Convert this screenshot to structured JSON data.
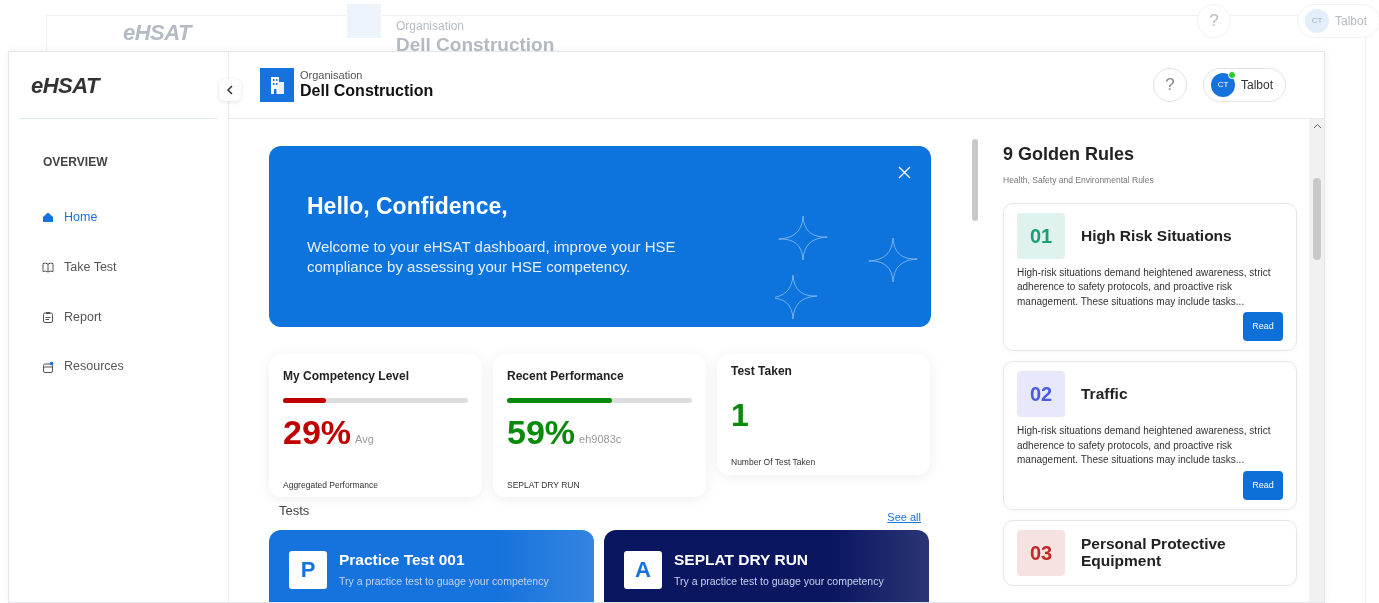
{
  "background_window": {
    "logo": "eHSAT",
    "org_label": "Organisation",
    "org_name": "Dell Construction",
    "help": "?",
    "user_initials": "CT",
    "user_name": "Talbot"
  },
  "sidebar": {
    "logo": "eHSAT",
    "section": "OVERVIEW",
    "items": [
      {
        "label": "Home",
        "kind": "home",
        "selected": true
      },
      {
        "label": "Take Test",
        "kind": "book",
        "selected": false
      },
      {
        "label": "Report",
        "kind": "clipboard",
        "selected": false
      },
      {
        "label": "Resources",
        "kind": "folder",
        "selected": false
      }
    ]
  },
  "header": {
    "org_label": "Organisation",
    "org_name": "Dell Construction",
    "help": "?",
    "user": {
      "initials": "CT",
      "name": "Talbot",
      "online": true
    }
  },
  "banner": {
    "title": "Hello, Confidence,",
    "message": "Welcome to your eHSAT dashboard, improve your HSE compliance by assessing your HSE competency."
  },
  "stats": [
    {
      "kind": "meter",
      "title": "My Competency Level",
      "level": 0.23,
      "value": "29%",
      "suffix": "Avg",
      "caption": "Aggregated Performance",
      "color": "#c00000"
    },
    {
      "kind": "meter",
      "title": "Recent Performance",
      "level": 0.57,
      "value": "59%",
      "suffix": "eh9083c",
      "caption": "SEPLAT DRY RUN",
      "color": "#0a8a0a"
    },
    {
      "kind": "count",
      "title": "Test Taken",
      "value": "1",
      "caption": "Number Of Test Taken",
      "color": "#0a8a0a"
    }
  ],
  "tests": {
    "title": "Tests",
    "see_all": "See all",
    "items": [
      {
        "letter": "P",
        "name": "Practice Test 001",
        "description": "Try a practice test to guage your competency",
        "color": "#1672dc"
      },
      {
        "letter": "A",
        "name": "SEPLAT DRY RUN",
        "description": "Try a practice test to guage your competency",
        "color": "#0a1660"
      }
    ]
  },
  "rules": {
    "title": "9 Golden Rules",
    "subtitle": "Health, Safety and Environmental Rules",
    "items": [
      {
        "number": "01",
        "title": "High Risk Situations",
        "text": "High-risk situations demand heightened awareness, strict adherence to safety protocols, and proactive risk management. These situations may include tasks...",
        "button": "Read",
        "color": "#1a9e78"
      },
      {
        "number": "02",
        "title": "Traffic",
        "text": "High-risk situations demand heightened awareness, strict adherence to safety protocols, and proactive risk management. These situations may include tasks...",
        "button": "Read",
        "color": "#4a5be0"
      },
      {
        "number": "03",
        "title": "Personal Protective Equipment",
        "color": "#c62828"
      }
    ]
  }
}
